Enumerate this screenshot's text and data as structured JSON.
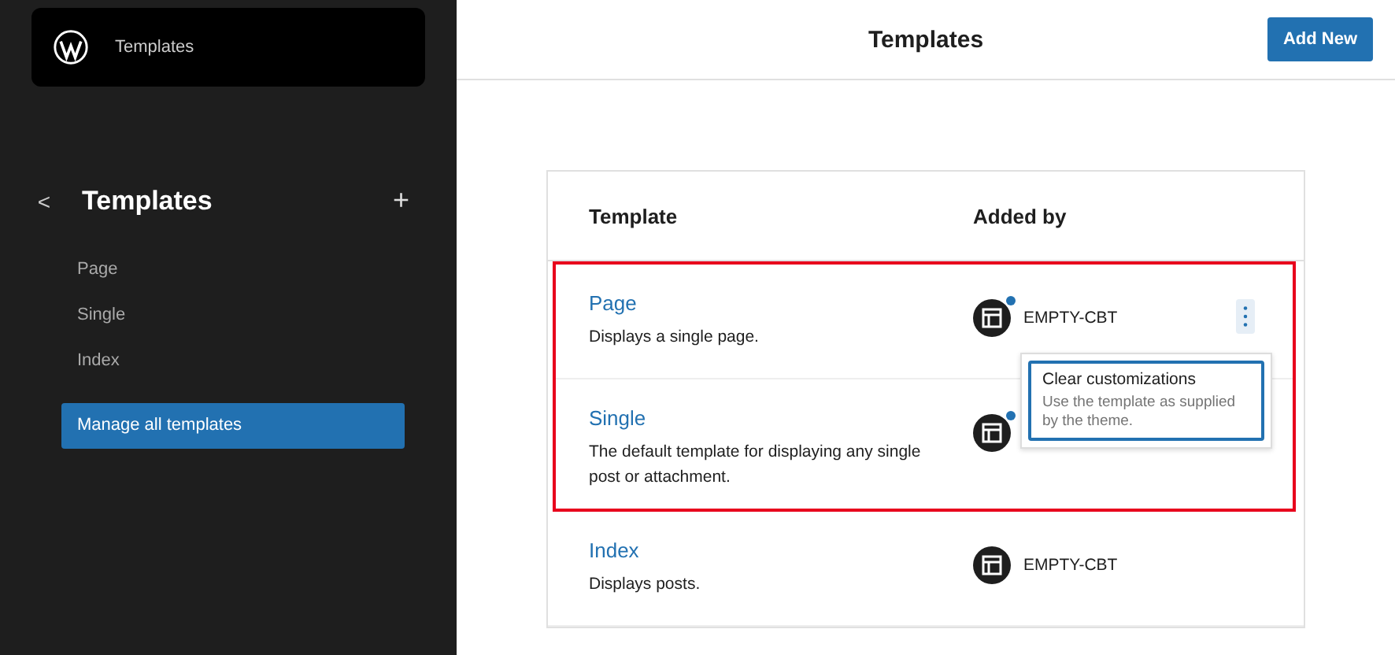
{
  "site_hub": {
    "title": "Templates"
  },
  "sidebar": {
    "title": "Templates",
    "back": "<",
    "add": "+",
    "items": [
      {
        "label": "Page",
        "selected": false
      },
      {
        "label": "Single",
        "selected": false
      },
      {
        "label": "Index",
        "selected": false
      },
      {
        "label": "Manage all templates",
        "selected": true
      }
    ]
  },
  "header": {
    "title": "Templates",
    "add_button": "Add New"
  },
  "table": {
    "columns": [
      "Template",
      "Added by"
    ],
    "rows": [
      {
        "name": "Page",
        "description": "Displays a single page.",
        "added_by": "EMPTY-CBT",
        "customized": true,
        "highlighted": true,
        "menu": {
          "open": true,
          "items": [
            {
              "label": "Clear customizations",
              "description": "Use the template as supplied by the theme."
            }
          ]
        }
      },
      {
        "name": "Single",
        "description": "The default template for displaying any single post or attachment.",
        "customized": true,
        "highlighted": true
      },
      {
        "name": "Index",
        "description": "Displays posts.",
        "added_by": "EMPTY-CBT",
        "customized": false,
        "highlighted": false
      }
    ]
  }
}
